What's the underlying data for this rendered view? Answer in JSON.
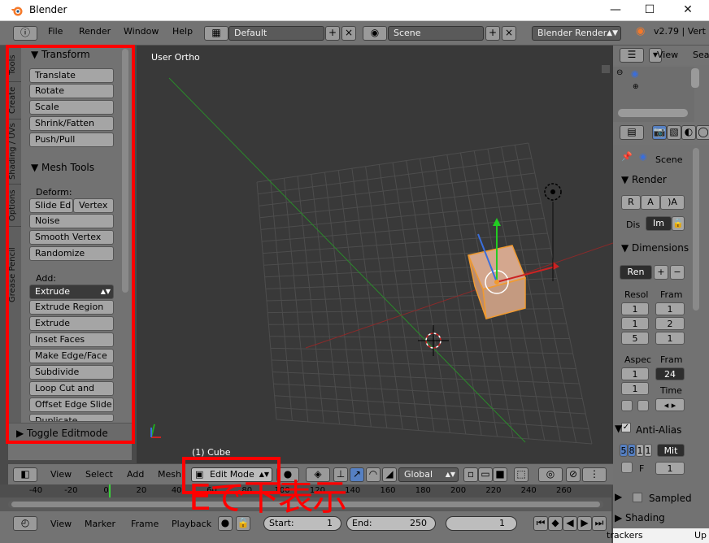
{
  "window": {
    "title": "Blender"
  },
  "info_header": {
    "menus": [
      "File",
      "Render",
      "Window",
      "Help"
    ],
    "layout": "Default",
    "scene": "Scene",
    "engine": "Blender Render",
    "version": "v2.79 | Vert"
  },
  "tool_tabs": [
    "Tools",
    "Create",
    "Shading / UVs",
    "Options",
    "Grease Pencil"
  ],
  "transform": {
    "title": "Transform",
    "buttons": [
      "Translate",
      "Rotate",
      "Scale",
      "Shrink/Fatten",
      "Push/Pull"
    ]
  },
  "mesh_tools": {
    "title": "Mesh Tools",
    "deform_label": "Deform:",
    "slide_edge": "Slide Ed",
    "vertex": "Vertex",
    "deform_buttons": [
      "Noise",
      "Smooth Vertex",
      "Randomize"
    ],
    "add_label": "Add:",
    "extrude": "Extrude",
    "add_buttons": [
      "Extrude Region",
      "Extrude Individual",
      "Inset Faces",
      "Make Edge/Face",
      "Subdivide",
      "Loop Cut and Slide",
      "Offset Edge Slide",
      "Duplicate"
    ]
  },
  "toggle_editmode": "Toggle Editmode",
  "viewport": {
    "view_label": "User Ortho",
    "object_label": "(1) Cube"
  },
  "view3d_header": {
    "menus": [
      "View",
      "Select",
      "Add",
      "Mesh"
    ],
    "mode": "Edit Mode",
    "orientation": "Global"
  },
  "timeline": {
    "ticks": [
      "-40",
      "-20",
      "0",
      "20",
      "40",
      "60",
      "80",
      "100",
      "120",
      "140",
      "160",
      "180",
      "200",
      "220",
      "240",
      "260"
    ],
    "menus": [
      "View",
      "Marker",
      "Frame",
      "Playback"
    ],
    "start_label": "Start:",
    "start_value": "1",
    "end_label": "End:",
    "end_value": "250",
    "current_frame": "1"
  },
  "annotation": "Eで下表示",
  "outliner": {
    "view_label": "View",
    "search_label": "Sea"
  },
  "properties": {
    "scene": "Scene",
    "render_title": "Render",
    "render_btn": "R",
    "anim_btn": "A",
    "audio_btn": ")A",
    "display_label": "Dis",
    "display_value": "Im",
    "dimensions_title": "Dimensions",
    "preset": "Ren",
    "resolution_label": "Resol",
    "frame_label": "Fram",
    "res_values": [
      "1",
      "1",
      "5"
    ],
    "frame_values": [
      "1",
      "2",
      "1"
    ],
    "aspect_label": "Aspec",
    "fps_label": "Fram",
    "aspect_values": [
      "1",
      "1"
    ],
    "fps_value": "24",
    "time_label": "Time",
    "antialias_title": "Anti-Alias",
    "aa_samples": [
      "5",
      "8",
      "1",
      "1"
    ],
    "aa_filter": "Mit",
    "aa_f_label": "F",
    "aa_f_value": "1",
    "sampled_title": "Sampled",
    "shading_title": "Shading"
  },
  "taskbar": {
    "item1": "trackers",
    "item2": "Up"
  },
  "colors": {
    "annotation": "#ff0000",
    "selected_object": "#e8a55a",
    "x_axis": "#cc2222",
    "y_axis": "#22aa22"
  }
}
